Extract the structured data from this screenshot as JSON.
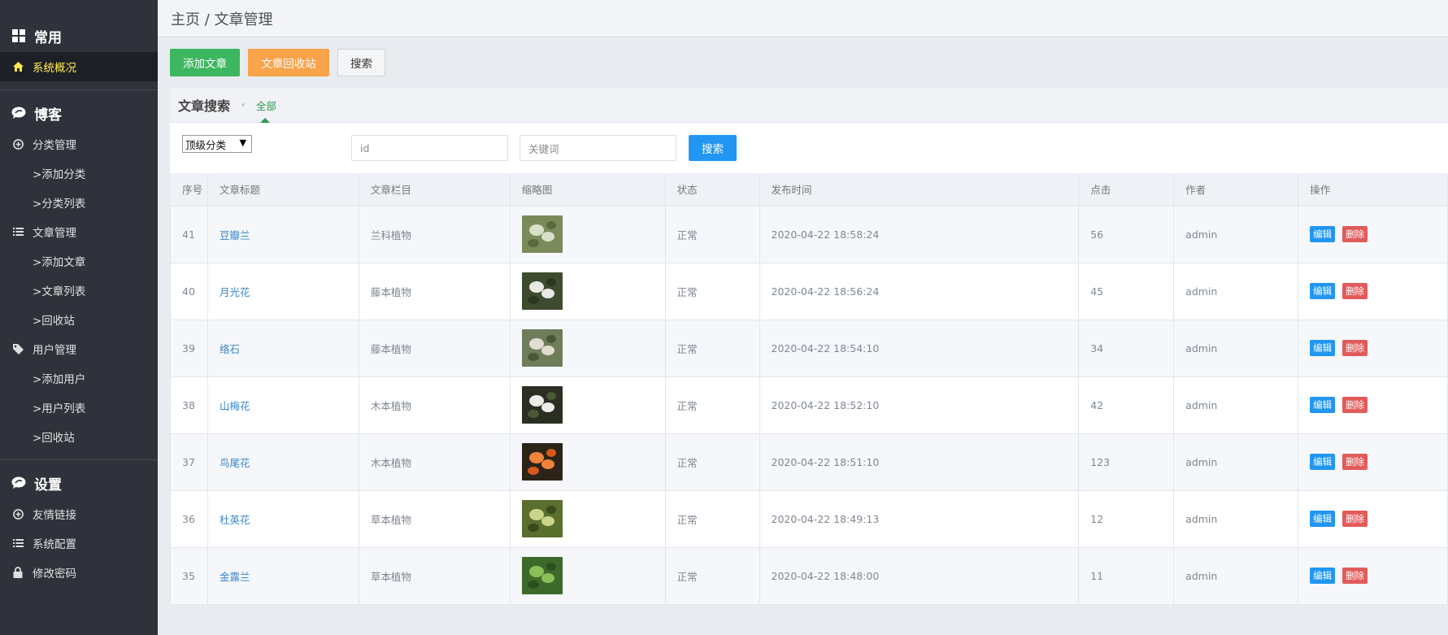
{
  "sidebar": {
    "sections": [
      {
        "title": "常用",
        "icon": "grid-icon",
        "items": [
          {
            "label": "系统概况",
            "icon": "home-icon",
            "active": true
          }
        ]
      },
      {
        "title": "博客",
        "icon": "chat-bubble-icon",
        "items": [
          {
            "label": "分类管理",
            "icon": "plus-circle-icon"
          },
          {
            "label": ">添加分类",
            "sub": true
          },
          {
            "label": ">分类列表",
            "sub": true
          },
          {
            "label": "文章管理",
            "icon": "list-icon"
          },
          {
            "label": ">添加文章",
            "sub": true
          },
          {
            "label": ">文章列表",
            "sub": true
          },
          {
            "label": ">回收站",
            "sub": true
          },
          {
            "label": "用户管理",
            "icon": "tag-icon"
          },
          {
            "label": ">添加用户",
            "sub": true
          },
          {
            "label": ">用户列表",
            "sub": true
          },
          {
            "label": ">回收站",
            "sub": true
          }
        ]
      },
      {
        "title": "设置",
        "icon": "chat-bubble-icon",
        "items": [
          {
            "label": "友情链接",
            "icon": "plus-circle-icon"
          },
          {
            "label": "系统配置",
            "icon": "list-icon"
          },
          {
            "label": "修改密码",
            "icon": "lock-icon"
          }
        ]
      }
    ]
  },
  "breadcrumb": "主页 / 文章管理",
  "actions": {
    "add": "添加文章",
    "recycle": "文章回收站",
    "search": "搜索"
  },
  "search_panel": {
    "title": "文章搜索",
    "tab": "全部",
    "select_value": "顶级分类",
    "id_placeholder": "id",
    "keyword_placeholder": "关键词",
    "search_button": "搜索"
  },
  "table": {
    "headers": [
      "序号",
      "文章标题",
      "文章栏目",
      "缩略图",
      "状态",
      "发布时间",
      "点击",
      "作者",
      "操作"
    ],
    "edit_label": "编辑",
    "delete_label": "删除",
    "rows": [
      {
        "id": "41",
        "title": "豆瓣兰",
        "category": "兰科植物",
        "status": "正常",
        "time": "2020-04-22 18:58:24",
        "clicks": "56",
        "author": "admin",
        "thumb": [
          "#7a8a5a",
          "#d8e0c8",
          "#5b6a3c"
        ]
      },
      {
        "id": "40",
        "title": "月光花",
        "category": "藤本植物",
        "status": "正常",
        "time": "2020-04-22 18:56:24",
        "clicks": "45",
        "author": "admin",
        "thumb": [
          "#3f4b2f",
          "#e8e8e4",
          "#2c3520"
        ]
      },
      {
        "id": "39",
        "title": "络石",
        "category": "藤本植物",
        "status": "正常",
        "time": "2020-04-22 18:54:10",
        "clicks": "34",
        "author": "admin",
        "thumb": [
          "#6f7c5a",
          "#e0dccf",
          "#4b5638"
        ]
      },
      {
        "id": "38",
        "title": "山梅花",
        "category": "木本植物",
        "status": "正常",
        "time": "2020-04-22 18:52:10",
        "clicks": "42",
        "author": "admin",
        "thumb": [
          "#2a2f22",
          "#ecece8",
          "#4a5a33"
        ]
      },
      {
        "id": "37",
        "title": "鸟尾花",
        "category": "木本植物",
        "status": "正常",
        "time": "2020-04-22 18:51:10",
        "clicks": "123",
        "author": "admin",
        "thumb": [
          "#2c2418",
          "#f0823a",
          "#d45a1c"
        ]
      },
      {
        "id": "36",
        "title": "杜英花",
        "category": "草本植物",
        "status": "正常",
        "time": "2020-04-22 18:49:13",
        "clicks": "12",
        "author": "admin",
        "thumb": [
          "#5a6e2e",
          "#c8d48a",
          "#3a4a1c"
        ]
      },
      {
        "id": "35",
        "title": "金露兰",
        "category": "草本植物",
        "status": "正常",
        "time": "2020-04-22 18:48:00",
        "clicks": "11",
        "author": "admin",
        "thumb": [
          "#3d6a2a",
          "#8ac05a",
          "#2a4e1c"
        ]
      }
    ]
  }
}
